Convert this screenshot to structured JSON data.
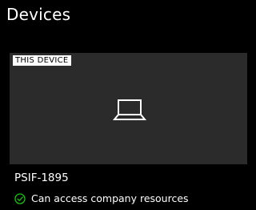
{
  "page": {
    "title": "Devices"
  },
  "device": {
    "badge": "THIS DEVICE",
    "icon": "laptop-icon",
    "name": "PSIF-1895",
    "status_text": "Can access company resources",
    "status_icon": "check-circle-icon",
    "status_color": "#16c60c"
  },
  "colors": {
    "background": "#000000",
    "tile_background": "#2b2b2b",
    "text": "#ffffff",
    "badge_background": "#ffffff",
    "badge_text": "#000000"
  }
}
